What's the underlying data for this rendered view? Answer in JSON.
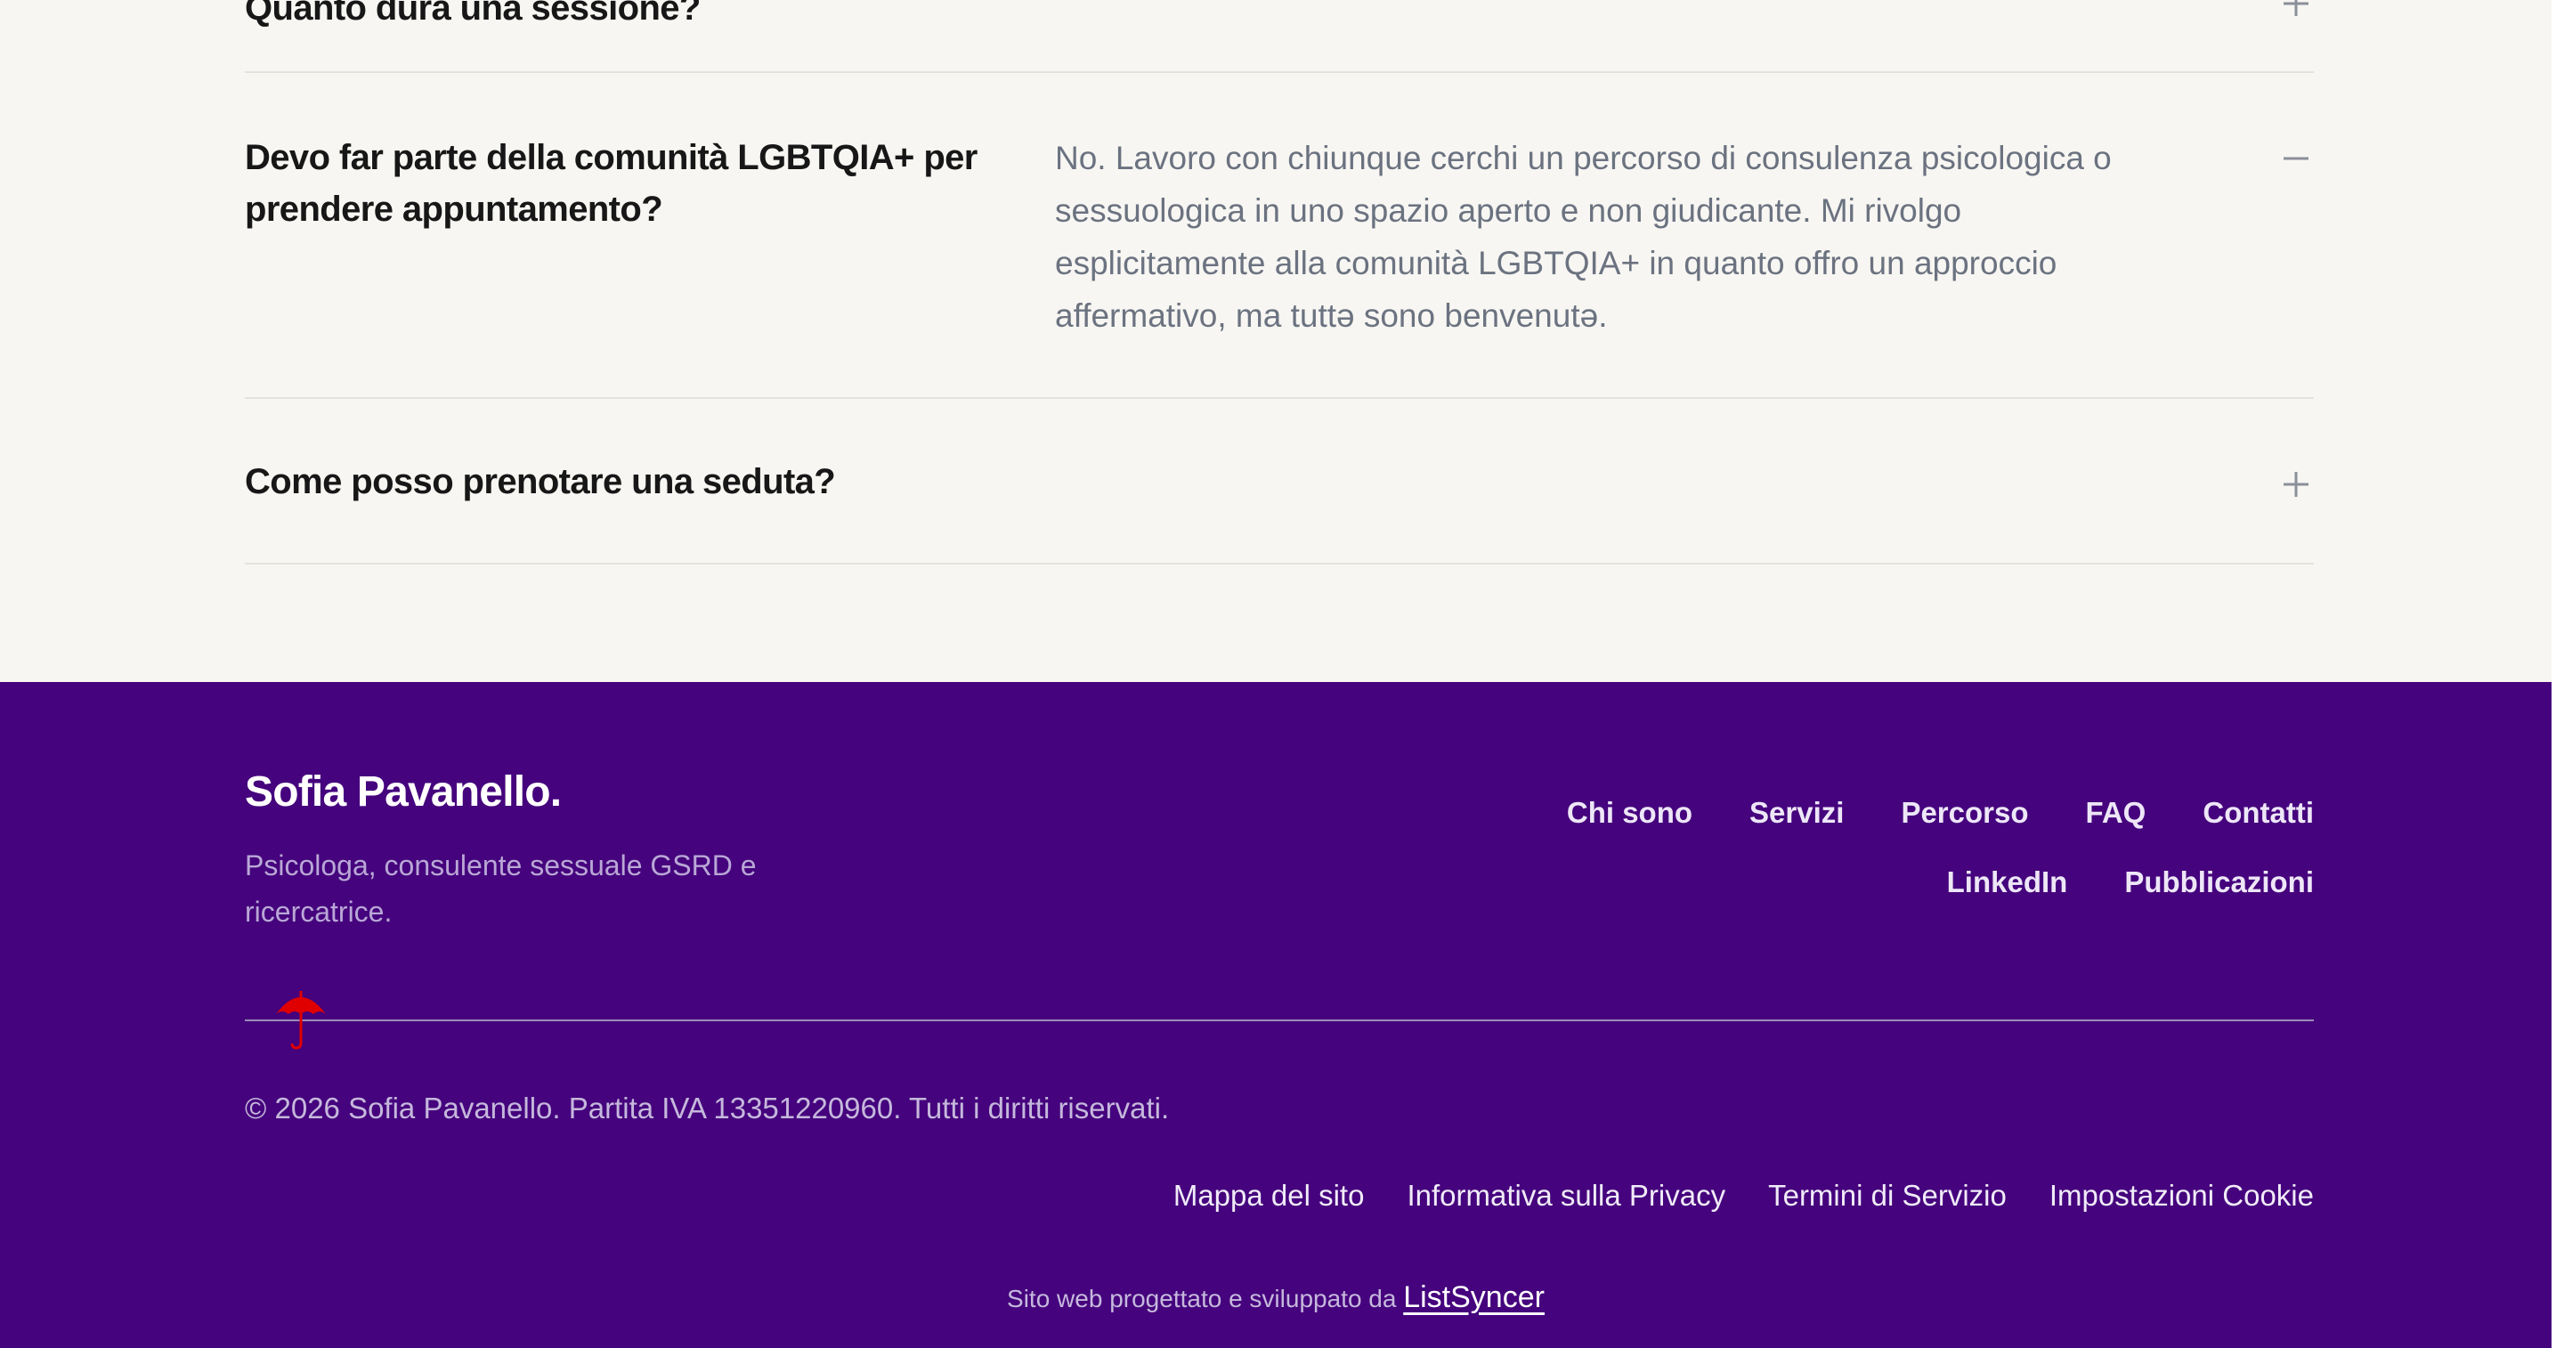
{
  "faq": {
    "items": [
      {
        "question": "Quanto dura una sessione?",
        "expanded": false,
        "toggle_icon": "plus-icon"
      },
      {
        "question": "Devo far parte della comunità LGBTQIA+ per prendere appuntamento?",
        "answer": "No. Lavoro con chiunque cerchi un percorso di consulenza psicologica o sessuologica in uno spazio aperto e non giudicante. Mi rivolgo esplicitamente alla comunità LGBTQIA+ in quanto offro un approccio affermativo, ma tuttə sono benvenutə.",
        "expanded": true,
        "toggle_icon": "minus-icon"
      },
      {
        "question": "Come posso prenotare una seduta?",
        "expanded": false,
        "toggle_icon": "plus-icon"
      }
    ]
  },
  "footer": {
    "brand": "Sofia Pavanello.",
    "tagline": "Psicologa, consulente sessuale GSRD e ricercatrice.",
    "nav_primary": [
      "Chi sono",
      "Servizi",
      "Percorso",
      "FAQ",
      "Contatti"
    ],
    "nav_secondary": [
      "LinkedIn",
      "Pubblicazioni"
    ],
    "copyright": "© 2026 Sofia Pavanello. Partita IVA 13351220960. Tutti i diritti riservati.",
    "legal_links": [
      "Mappa del sito",
      "Informativa sulla Privacy",
      "Termini di Servizio",
      "Impostazioni Cookie"
    ],
    "credit_text": "Sito web progettato e sviluppato da",
    "credit_link": "ListSyncer",
    "umbrella_icon": "umbrella-icon"
  },
  "colors": {
    "faq_background": "#f7f6f2",
    "footer_background": "#45037d",
    "umbrella": "#e00000",
    "question_text": "#171717",
    "answer_text": "#6b7280"
  }
}
